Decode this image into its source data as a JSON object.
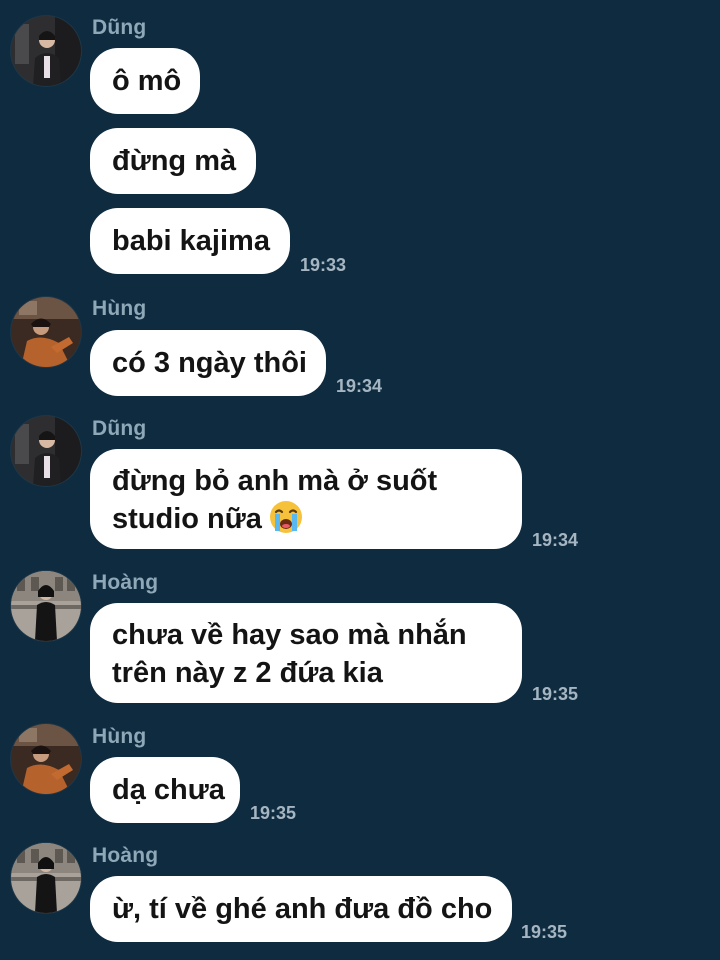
{
  "messages": [
    {
      "sender": "Dũng",
      "lines": [
        "ô mô"
      ]
    },
    {
      "lines": [
        "đừng mà"
      ]
    },
    {
      "lines": [
        "babi kajima"
      ],
      "time": "19:33"
    },
    {
      "sender": "Hùng",
      "lines": [
        "có 3 ngày thôi"
      ],
      "time": "19:34"
    },
    {
      "sender": "Dũng",
      "lines": [
        "đừng bỏ anh mà ở suốt",
        "studio nữa"
      ],
      "emoji": "loudly-crying-face",
      "time": "19:34"
    },
    {
      "sender": "Hoàng",
      "lines": [
        "chưa về hay sao mà nhắn",
        "trên này z 2 đứa kia"
      ],
      "time": "19:35"
    },
    {
      "sender": "Hùng",
      "lines": [
        "dạ chưa"
      ],
      "time": "19:35"
    },
    {
      "sender": "Hoàng",
      "lines": [
        "ừ, tí về ghé anh đưa đồ cho"
      ],
      "time": "19:35"
    }
  ],
  "colors": {
    "background": "#0f2b3f",
    "bubble": "#ffffff",
    "sender_name": "#8fa8b8",
    "timestamp": "#a5b5c1"
  },
  "icons": [
    "avatar-dung",
    "avatar-hung",
    "avatar-hoang",
    "loudly-crying-face-emoji"
  ]
}
